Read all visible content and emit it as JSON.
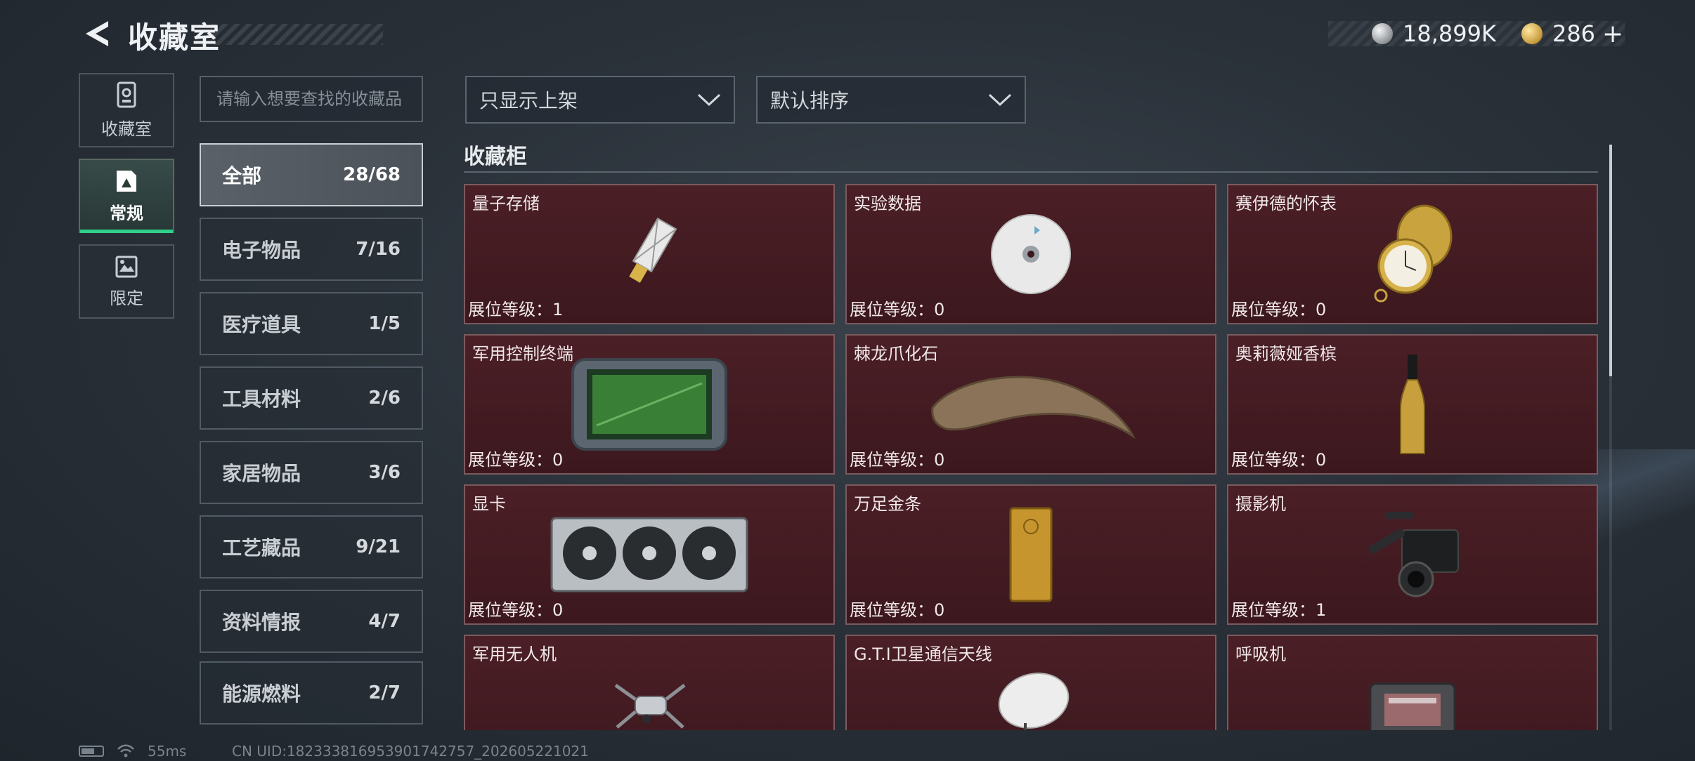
{
  "header": {
    "title": "收藏室",
    "currency_silver": "18,899K",
    "currency_gold": "286",
    "plus": "+"
  },
  "side_tabs": [
    {
      "label": "收藏室",
      "icon": "trophy-cabinet-icon",
      "active": false
    },
    {
      "label": "常规",
      "icon": "card-icon",
      "active": true
    },
    {
      "label": "限定",
      "icon": "limited-frame-icon",
      "active": false
    }
  ],
  "search": {
    "placeholder": "请输入想要查找的收藏品"
  },
  "categories": [
    {
      "name": "全部",
      "count": "28/68",
      "active": true
    },
    {
      "name": "电子物品",
      "count": "7/16"
    },
    {
      "name": "医疗道具",
      "count": "1/5"
    },
    {
      "name": "工具材料",
      "count": "2/6"
    },
    {
      "name": "家居物品",
      "count": "3/6"
    },
    {
      "name": "工艺藏品",
      "count": "9/21"
    },
    {
      "name": "资料情报",
      "count": "4/7"
    },
    {
      "name": "能源燃料",
      "count": "2/7"
    }
  ],
  "filters": {
    "display": "只显示上架",
    "sort": "默认排序"
  },
  "section": {
    "title": "收藏柜"
  },
  "items": [
    {
      "name": "量子存储",
      "level": "展位等级：1",
      "icon": "usb-drive-icon"
    },
    {
      "name": "实验数据",
      "level": "展位等级：0",
      "icon": "disc-icon"
    },
    {
      "name": "赛伊德的怀表",
      "level": "展位等级：0",
      "icon": "pocket-watch-icon"
    },
    {
      "name": "军用控制终端",
      "level": "展位等级：0",
      "icon": "control-terminal-icon"
    },
    {
      "name": "棘龙爪化石",
      "level": "展位等级：0",
      "icon": "claw-fossil-icon"
    },
    {
      "name": "奥莉薇娅香槟",
      "level": "展位等级：0",
      "icon": "champagne-bottle-icon"
    },
    {
      "name": "显卡",
      "level": "展位等级：0",
      "icon": "graphics-card-icon"
    },
    {
      "name": "万足金条",
      "level": "展位等级：0",
      "icon": "gold-bar-icon"
    },
    {
      "name": "摄影机",
      "level": "展位等级：1",
      "icon": "camera-icon"
    },
    {
      "name": "军用无人机",
      "level": "",
      "icon": "drone-icon"
    },
    {
      "name": "G.T.I卫星通信天线",
      "level": "",
      "icon": "satellite-dish-icon"
    },
    {
      "name": "呼吸机",
      "level": "",
      "icon": "ventilator-icon"
    }
  ],
  "footer": {
    "ping": "55ms",
    "uid": "CN UID:18233381695390174275​7_202605221021"
  },
  "colors": {
    "accent_green": "#2fd08a",
    "card_bg": "#4b1f26",
    "card_border": "#7a5a5e"
  }
}
